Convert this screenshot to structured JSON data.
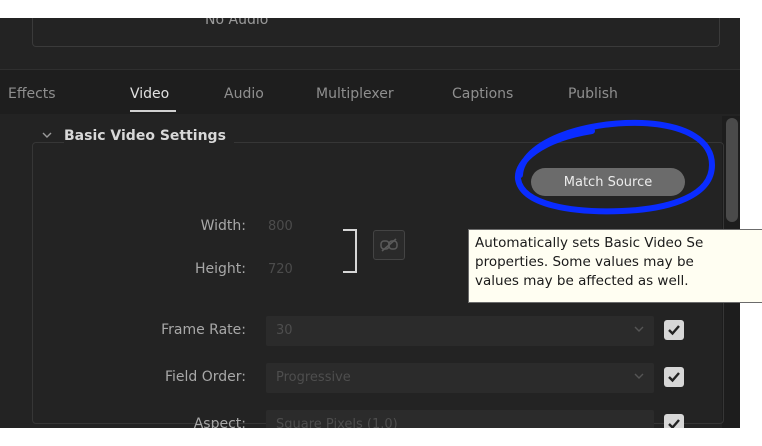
{
  "audio": {
    "label": "No Audio"
  },
  "tabs": [
    {
      "label": "Effects",
      "active": false
    },
    {
      "label": "Video",
      "active": true
    },
    {
      "label": "Audio",
      "active": false
    },
    {
      "label": "Multiplexer",
      "active": false
    },
    {
      "label": "Captions",
      "active": false
    },
    {
      "label": "Publish",
      "active": false
    }
  ],
  "section": {
    "title": "Basic Video Settings",
    "expanded": true
  },
  "match_source": {
    "label": "Match Source"
  },
  "fields": {
    "width": {
      "label": "Width:",
      "value": "800"
    },
    "height": {
      "label": "Height:",
      "value": "720"
    },
    "frame_rate": {
      "label": "Frame Rate:",
      "value": "30",
      "checked": true
    },
    "field_order": {
      "label": "Field Order:",
      "value": "Progressive",
      "checked": true
    },
    "aspect": {
      "label": "Aspect:",
      "value": "Square Pixels (1.0)",
      "checked": true
    }
  },
  "tooltip": {
    "lines": [
      "Automatically sets Basic Video Se",
      "properties.  Some values may be",
      "values may be affected as well."
    ]
  },
  "icons": {
    "chevron": "chevron-down-icon",
    "link": "link-broken-icon",
    "checkbox": "checkmark-icon"
  },
  "colors": {
    "annotation": "#0a2cff",
    "background": "#232323",
    "tooltip_bg": "#fffef2"
  }
}
